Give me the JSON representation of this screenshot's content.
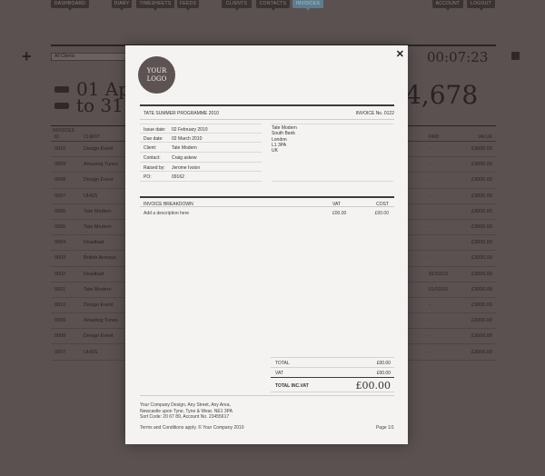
{
  "nav": {
    "items": [
      {
        "label": "DASHBOARD",
        "active": false
      },
      {
        "label": "DIARY",
        "active": false
      },
      {
        "label": "TIMESHEETS",
        "active": false
      },
      {
        "label": "FEEDS",
        "active": false
      },
      {
        "label": "CLIENTS",
        "active": false
      },
      {
        "label": "CONTACTS",
        "active": false
      },
      {
        "label": "INVOICES",
        "active": true
      },
      {
        "label": "ACCOUNT",
        "active": false
      },
      {
        "label": "LOGOUT",
        "active": false
      }
    ]
  },
  "toolbar": {
    "add_icon": "plus-icon",
    "client_filter": "All Clients",
    "timer": "00:07:23"
  },
  "summary": {
    "from_date": "01 Ap",
    "to_date": "to 31 I",
    "total": "4,678"
  },
  "invoices_table": {
    "title": "INVOICES",
    "headers": {
      "id": "ID",
      "client": "CLIENT",
      "paid": "PAID",
      "value": "VALUE"
    },
    "rows": [
      {
        "id": "0010",
        "client": "Design Event",
        "paid": "-",
        "value": "£3000.00"
      },
      {
        "id": "0009",
        "client": "Amazing Tunes",
        "paid": "-",
        "value": "£3000.00"
      },
      {
        "id": "0008",
        "client": "Design Event",
        "paid": "-",
        "value": "£3000.00"
      },
      {
        "id": "0007",
        "client": "UHSS",
        "paid": "-",
        "value": "£3000.00"
      },
      {
        "id": "0006",
        "client": "Tate Modern",
        "paid": "-",
        "value": "£3000.00"
      },
      {
        "id": "0005",
        "client": "Tate Modern",
        "paid": "-",
        "value": "£3000.00"
      },
      {
        "id": "0004",
        "client": "Deadbad",
        "paid": "-",
        "value": "£3000.00"
      },
      {
        "id": "0003",
        "client": "British Airways",
        "paid": "-",
        "value": "£3000.00"
      },
      {
        "id": "0002",
        "client": "Deadbad",
        "paid": "01/02/10",
        "value": "£3000.00"
      },
      {
        "id": "0001",
        "client": "Tate Modern",
        "paid": "01/02/10",
        "value": "£3000.00"
      },
      {
        "id": "0010",
        "client": "Design Event",
        "paid": "-",
        "value": "£3000.00"
      },
      {
        "id": "0009",
        "client": "Amazing Tunes",
        "paid": "-",
        "value": "£3000.00"
      },
      {
        "id": "0008",
        "client": "Design Event",
        "paid": "-",
        "value": "£3000.00"
      },
      {
        "id": "0007",
        "client": "UHSS",
        "paid": "-",
        "value": "£3000.00"
      }
    ]
  },
  "invoice": {
    "logo_line1": "YOUR",
    "logo_line2": "LOGO",
    "project_title": "TATE SUMMER PROGRAMME 2010",
    "invoice_number": "INVOICE No. 0122",
    "meta": [
      {
        "label": "Issue date:",
        "value": "02 February 2010"
      },
      {
        "label": "Due date:",
        "value": "02 March 2010"
      },
      {
        "label": "Client:",
        "value": "Tate Modern"
      },
      {
        "label": "Contact:",
        "value": "Craig askew"
      },
      {
        "label": "Raised by:",
        "value": "Jerome Ivsion"
      },
      {
        "label": "PO:",
        "value": "09162"
      }
    ],
    "address": [
      "Tate Modern",
      "South Bank",
      "London",
      "L1 3PA",
      "UK"
    ],
    "breakdown": {
      "header": "INVOICE BREAKDOWN",
      "vat_header": "VAT",
      "cost_header": "COST",
      "rows": [
        {
          "description": "Add a description here",
          "vat": "£00.00",
          "cost": "£00.00"
        }
      ]
    },
    "totals": {
      "total_label": "TOTAL",
      "total_value": "£00.00",
      "vat_label": "VAT",
      "vat_value": "£00.00",
      "grand_label": "TOTAL INC.VAT",
      "grand_value": "£00.00"
    },
    "footer": {
      "address_lines": [
        "Your Company Design, Any Street, Any Area,",
        "Newcastle upon Tyne, Tyne & Wear. NE1 3PA",
        "Sort Code: 20 67 89, Account No. 23455617"
      ],
      "terms": "Terms and Conditions apply. © Your Company 2010",
      "page": "Page 1/1"
    }
  }
}
